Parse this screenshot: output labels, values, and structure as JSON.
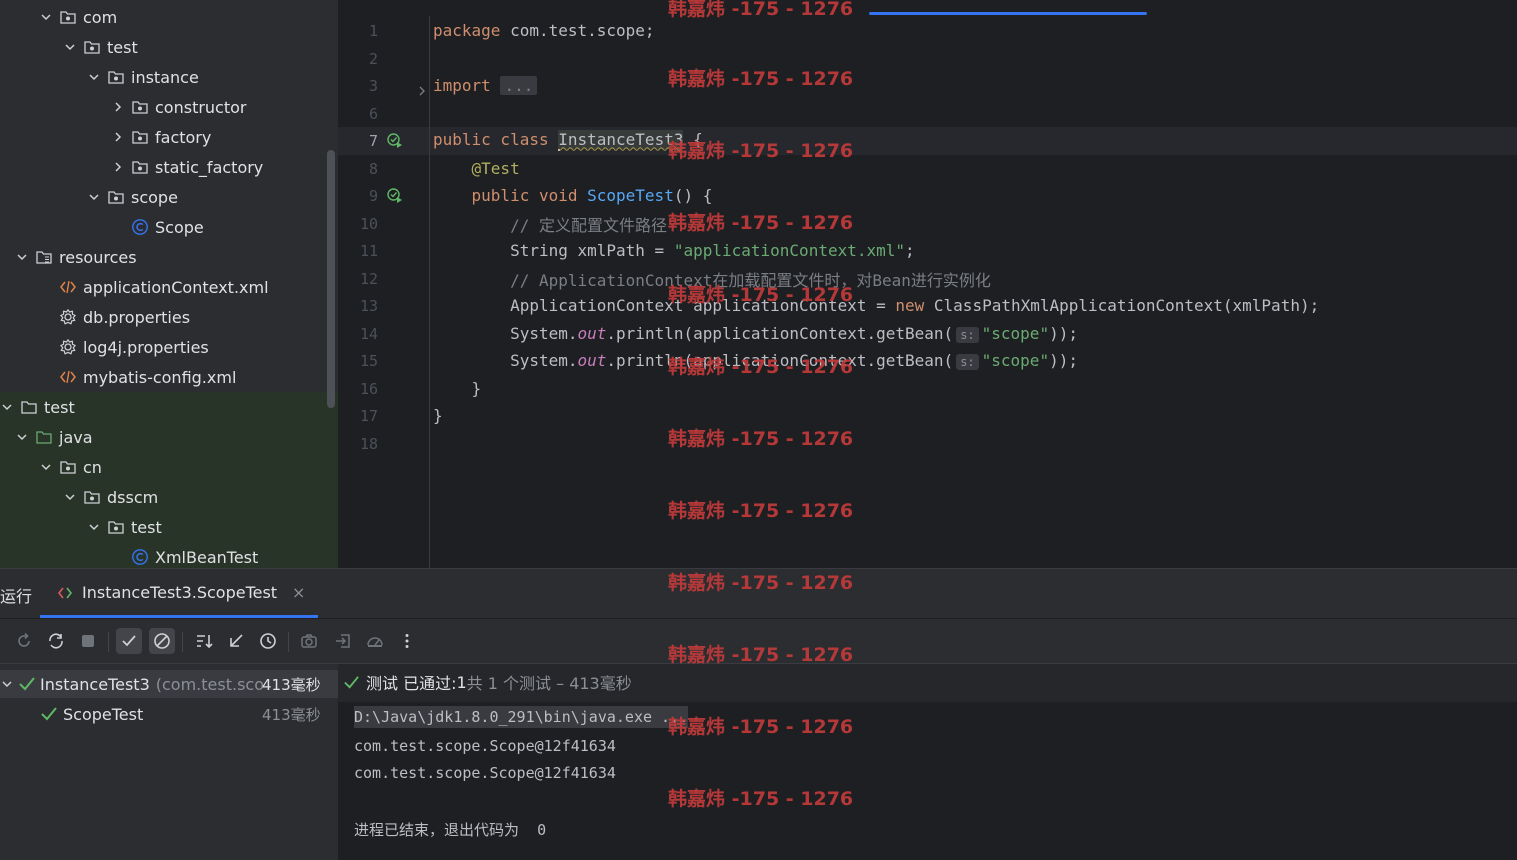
{
  "project_tree": {
    "items": [
      {
        "label": "com",
        "depth": 4,
        "expanded": true,
        "icon": "package-icon"
      },
      {
        "label": "test",
        "depth": 5,
        "expanded": true,
        "icon": "package-icon"
      },
      {
        "label": "instance",
        "depth": 6,
        "expanded": true,
        "icon": "package-icon"
      },
      {
        "label": "constructor",
        "depth": 7,
        "expanded": false,
        "icon": "package-icon"
      },
      {
        "label": "factory",
        "depth": 7,
        "expanded": false,
        "icon": "package-icon"
      },
      {
        "label": "static_factory",
        "depth": 7,
        "expanded": false,
        "icon": "package-icon"
      },
      {
        "label": "scope",
        "depth": 6,
        "expanded": true,
        "icon": "package-icon"
      },
      {
        "label": "Scope",
        "depth": 7,
        "expanded": null,
        "icon": "class-icon"
      },
      {
        "label": "resources",
        "depth": 3,
        "expanded": true,
        "icon": "resources-folder-icon"
      },
      {
        "label": "applicationContext.xml",
        "depth": 4,
        "expanded": null,
        "icon": "xml-file-icon"
      },
      {
        "label": "db.properties",
        "depth": 4,
        "expanded": null,
        "icon": "properties-file-icon"
      },
      {
        "label": "log4j.properties",
        "depth": 4,
        "expanded": null,
        "icon": "properties-file-icon"
      },
      {
        "label": "mybatis-config.xml",
        "depth": 4,
        "expanded": null,
        "icon": "xml-file-icon"
      },
      {
        "label": "test",
        "depth": 2,
        "expanded": true,
        "icon": "folder-icon"
      },
      {
        "label": "java",
        "depth": 3,
        "expanded": true,
        "icon": "test-source-folder-icon"
      },
      {
        "label": "cn",
        "depth": 4,
        "expanded": true,
        "icon": "package-icon"
      },
      {
        "label": "dsscm",
        "depth": 5,
        "expanded": true,
        "icon": "package-icon"
      },
      {
        "label": "test",
        "depth": 6,
        "expanded": true,
        "icon": "package-icon"
      },
      {
        "label": "XmlBeanTest",
        "depth": 7,
        "expanded": null,
        "icon": "class-icon"
      }
    ]
  },
  "editor": {
    "lines": [
      {
        "n": "1",
        "tokens": [
          [
            "kw",
            "package "
          ],
          [
            "plain",
            "com.test.scope;"
          ]
        ]
      },
      {
        "n": "2",
        "tokens": []
      },
      {
        "n": "3",
        "tokens": [
          [
            "kw",
            "import "
          ],
          [
            "fold",
            "..."
          ]
        ]
      },
      {
        "n": "6",
        "tokens": []
      },
      {
        "n": "7",
        "tokens": [
          [
            "kw",
            "public class "
          ],
          [
            "caret",
            ""
          ],
          [
            "sel",
            "InstanceTest3"
          ],
          [
            "plain",
            " {"
          ]
        ]
      },
      {
        "n": "8",
        "tokens": [
          [
            "plain",
            "    "
          ],
          [
            "ann",
            "@Test"
          ]
        ]
      },
      {
        "n": "9",
        "tokens": [
          [
            "plain",
            "    "
          ],
          [
            "kw",
            "public void "
          ],
          [
            "fn",
            "ScopeTest"
          ],
          [
            "plain",
            "() {"
          ]
        ]
      },
      {
        "n": "10",
        "tokens": [
          [
            "plain",
            "        "
          ],
          [
            "cmt",
            "// 定义配置文件路径"
          ]
        ]
      },
      {
        "n": "11",
        "tokens": [
          [
            "plain",
            "        String xmlPath = "
          ],
          [
            "str",
            "\"applicationContext.xml\""
          ],
          [
            "plain",
            ";"
          ]
        ]
      },
      {
        "n": "12",
        "tokens": [
          [
            "plain",
            "        "
          ],
          [
            "cmt",
            "// ApplicationContext在加载配置文件时，对Bean进行实例化"
          ]
        ]
      },
      {
        "n": "13",
        "tokens": [
          [
            "plain",
            "        ApplicationContext applicationContext = "
          ],
          [
            "kw",
            "new "
          ],
          [
            "plain",
            "ClassPathXmlApplicationContext(xmlPath);"
          ]
        ]
      },
      {
        "n": "14",
        "tokens": [
          [
            "plain",
            "        System."
          ],
          [
            "field",
            "out"
          ],
          [
            "plain",
            ".println(applicationContext.getBean("
          ],
          [
            "hint",
            "s:"
          ],
          [
            "str",
            "\"scope\""
          ],
          [
            "plain",
            "));"
          ]
        ]
      },
      {
        "n": "15",
        "tokens": [
          [
            "plain",
            "        System."
          ],
          [
            "field",
            "out"
          ],
          [
            "plain",
            ".println(applicationContext.getBean("
          ],
          [
            "hint",
            "s:"
          ],
          [
            "str",
            "\"scope\""
          ],
          [
            "plain",
            "));"
          ]
        ]
      },
      {
        "n": "16",
        "tokens": [
          [
            "plain",
            "    }"
          ]
        ]
      },
      {
        "n": "17",
        "tokens": [
          [
            "plain",
            "}"
          ]
        ]
      },
      {
        "n": "18",
        "tokens": []
      }
    ],
    "current_line": "7"
  },
  "watermark": {
    "text": "韩嘉炜 -175 - 1276"
  },
  "run_panel": {
    "title": "运行",
    "tab_label": "InstanceTest3.ScopeTest",
    "tab_close": "×",
    "status_prefix": "测试 已通过: ",
    "status_count": "1",
    "status_suffix": "共 1 个测试 – 413毫秒",
    "tests": [
      {
        "name": "InstanceTest3",
        "detail": "(com.test.sco",
        "time": "413毫秒"
      },
      {
        "name": "ScopeTest",
        "detail": "",
        "time": "413毫秒"
      }
    ],
    "console": {
      "path": "D:\\Java\\jdk1.8.0_291\\bin\\java.exe ...",
      "line1": "com.test.scope.Scope@12f41634",
      "line2": "com.test.scope.Scope@12f41634",
      "exit": "进程已结束，退出代码为  0"
    }
  },
  "colors": {
    "accent": "#3574f0",
    "pass": "#5fb865",
    "keyword": "#cf8e6d",
    "string": "#6aab73",
    "watermark": "#c23b3b"
  }
}
